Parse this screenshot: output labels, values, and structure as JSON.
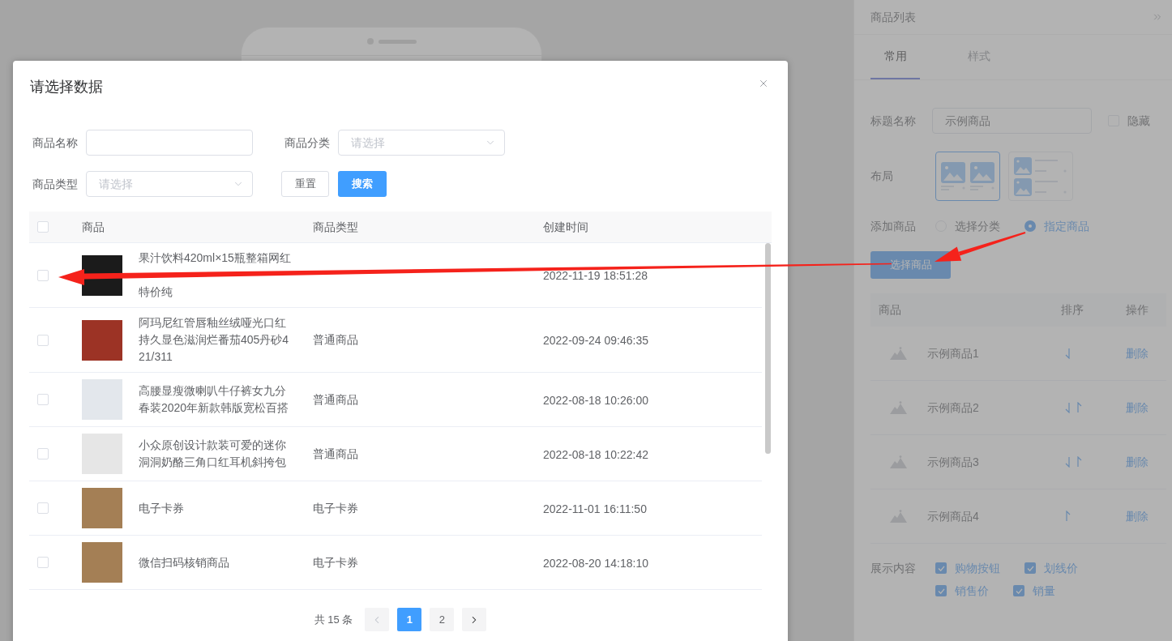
{
  "dialog": {
    "title": "请选择数据",
    "filters": [
      {
        "kind": "input",
        "label": "商品名称"
      },
      {
        "kind": "select",
        "label": "商品分类",
        "placeholder": "请选择"
      },
      {
        "kind": "select",
        "label": "商品类型",
        "placeholder": "请选择"
      }
    ],
    "buttons": [
      {
        "kind": "default",
        "label": "重置"
      },
      {
        "kind": "primary",
        "label": "搜索"
      }
    ],
    "table": {
      "select_all_checked": false,
      "columns": [
        "商品",
        "商品类型",
        "创建时间"
      ],
      "rows": [
        {
          "checked": false,
          "name": "果汁饮料420ml×15瓶整箱网红",
          "name_last_line": "特价纯",
          "created": "2022-11-19 18:51:28"
        },
        {
          "checked": false,
          "name": "阿玛尼红管唇釉丝绒哑光口红持久显色滋润烂番茄405丹砂421/311",
          "type": "普通商品",
          "created": "2022-09-24 09:46:35"
        },
        {
          "checked": false,
          "name": "高腰显瘦微喇叭牛仔裤女九分春装2020年新款韩版宽松百搭",
          "type": "普通商品",
          "created": "2022-08-18 10:26:00"
        },
        {
          "checked": false,
          "name": "小众原创设计款装可爱的迷你洞洞奶酪三角口红耳机斜挎包",
          "type": "普通商品",
          "created": "2022-08-18 10:22:42"
        },
        {
          "checked": false,
          "name": "电子卡券",
          "type": "电子卡券",
          "created": "2022-11-01 16:11:50"
        },
        {
          "checked": false,
          "name": "微信扫码核销商品",
          "type": "电子卡券",
          "created": "2022-08-20 14:18:10"
        }
      ]
    },
    "pagination": {
      "total": "共 15 条",
      "prev_disabled": true,
      "next_disabled": false,
      "pages": [
        {
          "label": "1",
          "selected": true
        },
        {
          "label": "2",
          "selected": false
        }
      ]
    }
  },
  "panel": {
    "title": "商品列表",
    "tabs": [
      {
        "label": "常用",
        "selected": true
      },
      {
        "label": "样式",
        "selected": false
      }
    ],
    "title_field": {
      "label": "标题名称",
      "value": "示例商品"
    },
    "hide": {
      "label": "隐藏",
      "checked": false
    },
    "layout": {
      "label": "布局",
      "options": [
        {
          "kind": "grid",
          "selected": true
        },
        {
          "kind": "list",
          "selected": false
        }
      ]
    },
    "add_products": {
      "label": "添加商品",
      "options": [
        {
          "label": "选择分类",
          "selected": false
        },
        {
          "label": "指定商品",
          "selected": true
        }
      ]
    },
    "select_button": "选择商品",
    "product_table": {
      "columns": [
        "商品",
        "排序",
        "操作"
      ],
      "rows": [
        {
          "name": "示例商品1",
          "move_down": true,
          "move_up": false,
          "action": "删除"
        },
        {
          "name": "示例商品2",
          "move_down": true,
          "move_up": true,
          "action": "删除"
        },
        {
          "name": "示例商品3",
          "move_down": true,
          "move_up": true,
          "action": "删除"
        },
        {
          "name": "示例商品4",
          "move_down": false,
          "move_up": true,
          "action": "删除"
        }
      ]
    },
    "display": {
      "label": "展示内容",
      "options": [
        {
          "label": "购物按钮",
          "checked": true
        },
        {
          "label": "划线价",
          "checked": true
        },
        {
          "label": "销售价",
          "checked": true
        },
        {
          "label": "销量",
          "checked": true
        }
      ]
    }
  }
}
